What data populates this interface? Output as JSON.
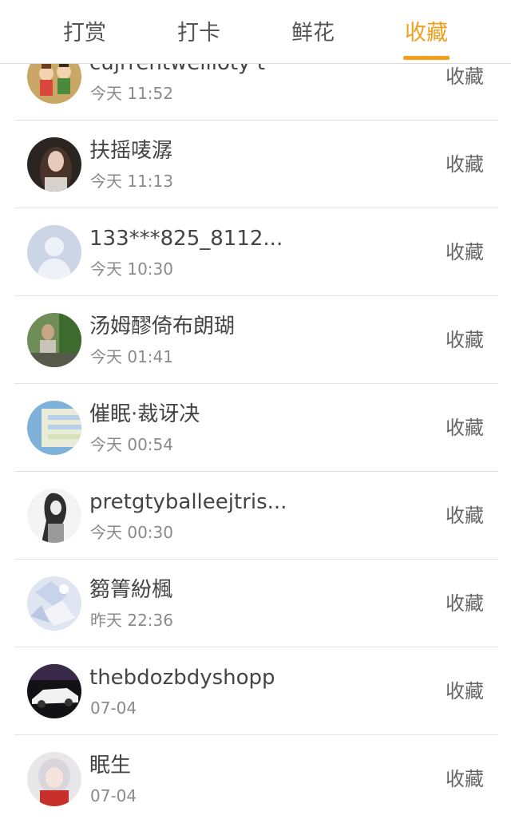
{
  "tabs": [
    {
      "label": "打赏"
    },
    {
      "label": "打卡"
    },
    {
      "label": "鲜花"
    },
    {
      "label": "收藏",
      "active": true
    }
  ],
  "accent_color": "#f0a01e",
  "items": [
    {
      "name": "cujrrentwellioty t",
      "time": "今天 11:52",
      "action": "收藏",
      "avatar_icon": "cartoon-kids-avatar"
    },
    {
      "name": "扶摇唛潺",
      "time": "今天 11:13",
      "action": "收藏",
      "avatar_icon": "woman-portrait-avatar"
    },
    {
      "name": "133***825_8112...",
      "time": "今天 10:30",
      "action": "收藏",
      "avatar_icon": "default-user-avatar"
    },
    {
      "name": "汤姆醪倚布朗瑚",
      "time": "今天 01:41",
      "action": "收藏",
      "avatar_icon": "person-outdoor-avatar"
    },
    {
      "name": "催眠·裁讶决",
      "time": "今天 00:54",
      "action": "收藏",
      "avatar_icon": "blurry-blue-avatar"
    },
    {
      "name": "pretgtyballeejtris...",
      "time": "今天 00:30",
      "action": "收藏",
      "avatar_icon": "sketch-girl-avatar"
    },
    {
      "name": "篘箐紛楓",
      "time": "昨天 22:36",
      "action": "收藏",
      "avatar_icon": "crystal-pattern-avatar"
    },
    {
      "name": "thebdozbdyshopp",
      "time": "07-04",
      "action": "收藏",
      "avatar_icon": "car-avatar"
    },
    {
      "name": "眠生",
      "time": "07-04",
      "action": "收藏",
      "avatar_icon": "anime-girl-avatar"
    }
  ]
}
